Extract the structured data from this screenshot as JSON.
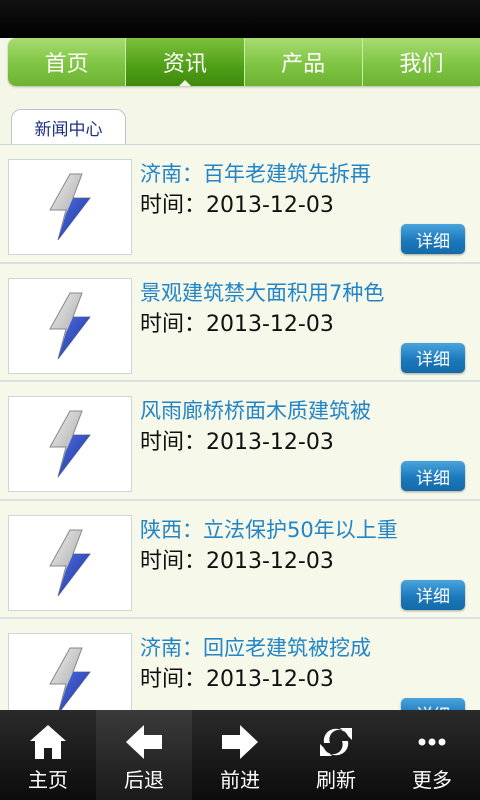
{
  "nav": {
    "tabs": [
      {
        "label": "首页"
      },
      {
        "label": "资讯"
      },
      {
        "label": "产品"
      },
      {
        "label": "我们"
      }
    ],
    "active_index": 1
  },
  "section": {
    "title": "新闻中心"
  },
  "news": [
    {
      "title": "济南：百年老建筑先拆再",
      "time": "时间：2013-12-03",
      "button": "详细",
      "thumb_icon": "lightning-icon"
    },
    {
      "title": "景观建筑禁大面积用7种色",
      "time": "时间：2013-12-03",
      "button": "详细",
      "thumb_icon": "lightning-icon"
    },
    {
      "title": "风雨廊桥桥面木质建筑被",
      "time": "时间：2013-12-03",
      "button": "详细",
      "thumb_icon": "lightning-icon"
    },
    {
      "title": "陕西：立法保护50年以上重",
      "time": "时间：2013-12-03",
      "button": "详细",
      "thumb_icon": "lightning-icon"
    },
    {
      "title": "济南：回应老建筑被挖成",
      "time": "时间：2013-12-03",
      "button": "详细",
      "thumb_icon": "lightning-icon"
    }
  ],
  "bottom_bar": [
    {
      "label": "主页",
      "icon": "home-icon"
    },
    {
      "label": "后退",
      "icon": "arrow-left-icon"
    },
    {
      "label": "前进",
      "icon": "arrow-right-icon"
    },
    {
      "label": "刷新",
      "icon": "refresh-icon"
    },
    {
      "label": "更多",
      "icon": "more-icon"
    }
  ],
  "colors": {
    "nav_green": "#7fc443",
    "nav_active": "#4f9e17",
    "title_blue": "#2385c6",
    "button_blue": "#1c79bc"
  }
}
